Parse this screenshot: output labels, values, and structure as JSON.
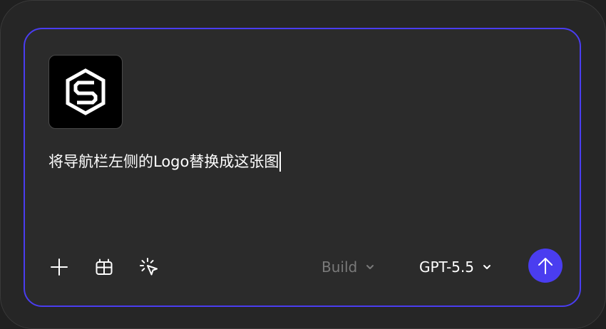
{
  "composer": {
    "prompt_text": "将导航栏左侧的Logo替换成这张图",
    "attachment": {
      "kind": "image",
      "icon": "logo-s-icon"
    }
  },
  "toolbar": {
    "add_icon": "plus-icon",
    "elements_icon": "layout-icon",
    "select_icon": "pointer-select-icon",
    "mode_label": "Build",
    "model_label": "GPT-5.5",
    "send_icon": "arrow-up-icon"
  },
  "colors": {
    "accent": "#4a3df0",
    "panel": "#262626",
    "composer": "#2b2b2b",
    "muted_text": "#7a7a7a"
  }
}
